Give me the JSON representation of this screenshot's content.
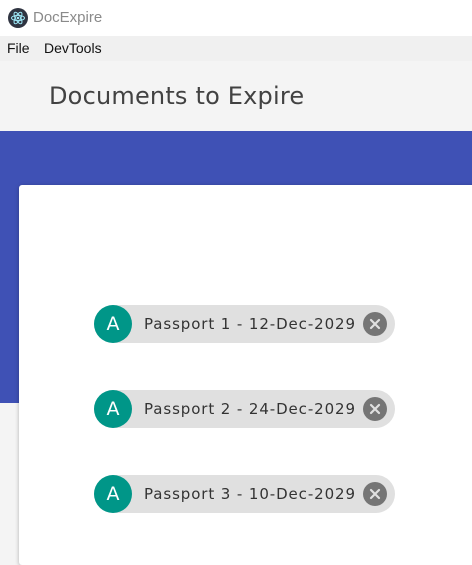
{
  "window": {
    "title": "DocExpire"
  },
  "menu": {
    "items": [
      {
        "label": "File"
      },
      {
        "label": "DevTools"
      }
    ]
  },
  "header": {
    "title": "Documents to Expire"
  },
  "colors": {
    "primary": "#3f51b5",
    "avatar": "#009688",
    "chip_bg": "#e0e0e0",
    "delete_icon": "#757575"
  },
  "documents": [
    {
      "avatar": "A",
      "label": "Passport 1 - 12-Dec-2029"
    },
    {
      "avatar": "A",
      "label": "Passport 2 - 24-Dec-2029"
    },
    {
      "avatar": "A",
      "label": "Passport 3 - 10-Dec-2029"
    }
  ]
}
